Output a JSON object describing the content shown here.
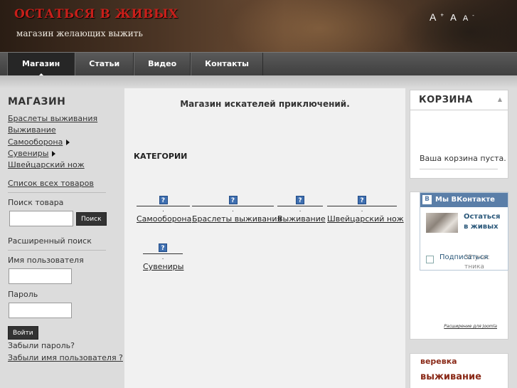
{
  "header": {
    "site_title": "ОСТАТЬСЯ В ЖИВЫХ",
    "slogan": "магазин желающих выжить",
    "font_size": {
      "increase": "A",
      "increase_sup": "+",
      "reset": "A",
      "decrease": "A",
      "decrease_sup": "-"
    }
  },
  "nav": {
    "items": [
      {
        "label": "Магазин",
        "active": true
      },
      {
        "label": "Статьи"
      },
      {
        "label": "Видео"
      },
      {
        "label": "Контакты"
      }
    ]
  },
  "left": {
    "heading": "МАГАЗИН",
    "categories": [
      "Браслеты выживания",
      "Выживание",
      "Самооборона",
      "Сувениры",
      "Швейцарский нож"
    ],
    "all_products": "Список всех товаров",
    "search_label": "Поиск товара",
    "search_button": "Поиск",
    "advanced_search": "Расширенный поиск",
    "username_label": "Имя пользователя",
    "password_label": "Пароль",
    "login_button": "Войти",
    "forgot_password": "Забыли пароль?",
    "forgot_username": "Забыли имя пользователя ?"
  },
  "main": {
    "title": "Магазин искателей приключений.",
    "categories_heading": "КАТЕГОРИИ",
    "categories": [
      "Самооборона",
      "Браслеты выживания",
      "Выживание",
      "Швейцарский нож",
      "Сувениры"
    ],
    "icon_glyph": "?",
    "dot": "."
  },
  "right": {
    "cart_title": "КОРЗИНА",
    "cart_collapse": "▲",
    "cart_empty": "Ваша корзина пуста.",
    "vk_title": "Мы ВКонтакте",
    "vk_logo": "В",
    "vk_group": "Остаться в живых",
    "vk_members": "32 участника",
    "vk_subscribe": "Подписаться",
    "vk_extension": "Расширение для Joomla",
    "tags": [
      "веревка",
      "выживание"
    ]
  }
}
